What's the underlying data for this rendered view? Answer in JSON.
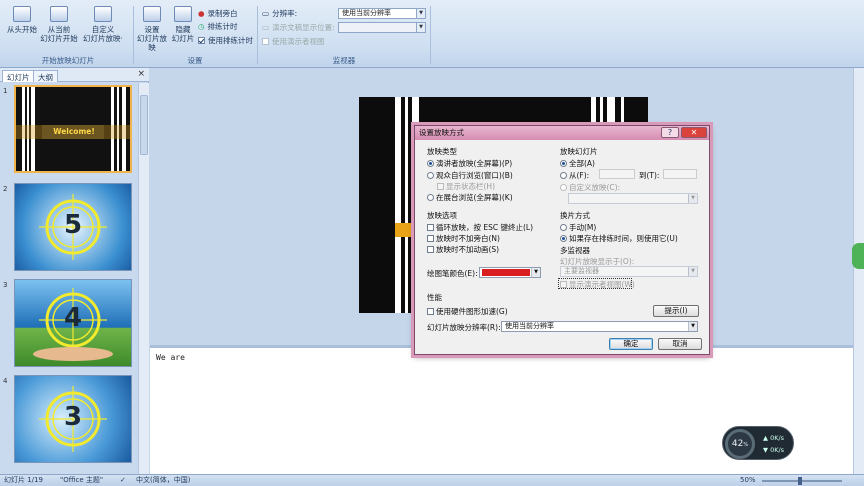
{
  "ribbon": {
    "start_group": {
      "label": "开始放映幻灯片",
      "buttons": [
        {
          "line1": "从头开始",
          "line2": ""
        },
        {
          "line1": "从当前",
          "line2": "幻灯片开始"
        },
        {
          "line1": "自定义",
          "line2": "幻灯片放映·"
        }
      ]
    },
    "setup_group": {
      "label": "设置",
      "buttons": [
        {
          "line1": "设置",
          "line2": "幻灯片放映"
        },
        {
          "line1": "隐藏",
          "line2": "幻灯片"
        }
      ],
      "small": [
        "录制旁白",
        "排练计时",
        "使用排练计时"
      ]
    },
    "monitor_group": {
      "label": "监视器",
      "resolution_label": "分辨率:",
      "resolution_value": "使用当前分辨率",
      "show_on_label": "演示文稿显示位置:",
      "presenter_label": "使用演示者视图"
    }
  },
  "leftpane": {
    "tabs": [
      "幻灯片",
      "大纲"
    ],
    "close": "×",
    "slides": [
      {
        "num": "1",
        "kind": "welcome",
        "text": "Welcome!"
      },
      {
        "num": "2",
        "kind": "countdown",
        "digit": "5"
      },
      {
        "num": "3",
        "kind": "countdown",
        "digit": "4"
      },
      {
        "num": "4",
        "kind": "countdown",
        "digit": "3"
      }
    ]
  },
  "notes": {
    "text": "We are"
  },
  "status": {
    "slide_info": "幻灯片 1/19",
    "theme": "\"Office 主题\"",
    "language": "中文(简体，中国)",
    "zoom": "50%"
  },
  "dialog": {
    "title": "设置放映方式",
    "help": "?",
    "close": "✕",
    "show_type": {
      "heading": "放映类型",
      "options": [
        "演讲者放映(全屏幕)(P)",
        "观众自行浏览(窗口)(B)",
        "在展台浏览(全屏幕)(K)"
      ],
      "selected": 0,
      "show_scrollbar": "显示状态栏(H)"
    },
    "slides": {
      "heading": "放映幻灯片",
      "all": "全部(A)",
      "from": "从(F):",
      "to": "到(T):",
      "custom": "自定义放映(C):"
    },
    "show_options": {
      "heading": "放映选项",
      "items": [
        "循环放映，按 ESC 键终止(L)",
        "放映时不加旁白(N)",
        "放映时不加动画(S)"
      ]
    },
    "pen_color_label": "绘图笔颜色(E):",
    "pen_color": "#d81e1e",
    "advance": {
      "heading": "换片方式",
      "manual": "手动(M)",
      "timings": "如果存在排练时间，则使用它(U)"
    },
    "monitors": {
      "heading": "多监视器",
      "show_on": "幻灯片放映显示于(O):",
      "monitor_value": "主要监视器",
      "presenter_view": "显示演示者视图(W)"
    },
    "performance": {
      "heading": "性能",
      "hardware": "使用硬件图形加速(G)",
      "tips": "提示(I)",
      "resolution_label": "幻灯片放映分辨率(R):",
      "resolution_value": "使用当前分辨率"
    },
    "ok": "确定",
    "cancel": "取消"
  },
  "timer_widget": {
    "percent": "42",
    "percent_unit": "%",
    "up": "0K/s",
    "down": "0K/s"
  }
}
